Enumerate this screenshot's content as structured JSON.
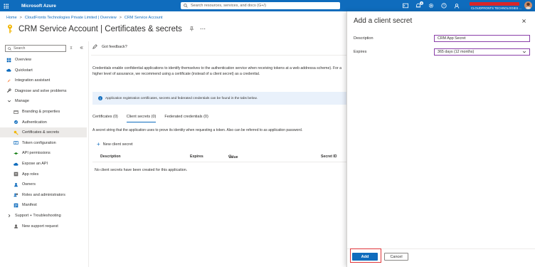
{
  "topbar": {
    "brand": "Microsoft Azure",
    "search_placeholder": "Search resources, services, and docs (G+/)",
    "notifications_count": "3",
    "account_org": "CLOUDFRONTS TECHNOLOGIES ..."
  },
  "breadcrumb": {
    "home": "Home",
    "sep1": ">",
    "tenant": "CloudFronts Technologies Private Limited | Overview",
    "sep2": ">",
    "app": "CRM Service Account"
  },
  "page": {
    "title_app": "CRM Service Account",
    "title_sep": "|",
    "title_section": "Certificates & secrets"
  },
  "nav": {
    "search_placeholder": "Search",
    "items": [
      {
        "label": "Overview",
        "icon": "grid-icon"
      },
      {
        "label": "Quickstart",
        "icon": "cloud-icon"
      },
      {
        "label": "Integration assistant",
        "icon": "rocket-icon"
      },
      {
        "label": "Diagnose and solve problems",
        "icon": "wrench-icon"
      },
      {
        "label": "Manage",
        "icon": "chevron-down-icon"
      },
      {
        "label": "Branding & properties",
        "icon": "branding-icon"
      },
      {
        "label": "Authentication",
        "icon": "auth-icon"
      },
      {
        "label": "Certificates & secrets",
        "icon": "key-icon"
      },
      {
        "label": "Token configuration",
        "icon": "token-icon"
      },
      {
        "label": "API permissions",
        "icon": "permissions-icon"
      },
      {
        "label": "Expose an API",
        "icon": "cloud-api-icon"
      },
      {
        "label": "App roles",
        "icon": "app-roles-icon"
      },
      {
        "label": "Owners",
        "icon": "owners-icon"
      },
      {
        "label": "Roles and administrators",
        "icon": "roles-icon"
      },
      {
        "label": "Manifest",
        "icon": "manifest-icon"
      },
      {
        "label": "Support + Troubleshooting",
        "icon": "chevron-right-icon"
      },
      {
        "label": "New support request",
        "icon": "support-icon"
      }
    ]
  },
  "content": {
    "feedback": "Got feedback?",
    "description": "Credentials enable confidential applications to identify themselves to the authentication service when receiving tokens at a web addressa scheme). For a higher level of assurance, we recommend using a certificate (instead of a client secret) as a credential.",
    "banner": "Application registration certificates, secrets and federated credentials can be found in the tabs below.",
    "tabs": [
      "Certificates (0)",
      "Client secrets (0)",
      "Federated credentials (0)"
    ],
    "tab_description": "A secret string that the application uses to prove its identity when requesting a token. Also can be referred to as application password.",
    "new_secret": "New client secret",
    "columns": [
      "Description",
      "Expires",
      "Value",
      "Secret ID"
    ],
    "empty": "No client secrets have been created for this application."
  },
  "panel": {
    "title": "Add a client secret",
    "description_label": "Description",
    "description_value": "CRM App Secret",
    "expires_label": "Expires",
    "expires_value": "365 days (12 months)",
    "add_label": "Add",
    "cancel_label": "Cancel"
  },
  "colors": {
    "accent": "#0f6cbd",
    "highlight": "#e0353a"
  }
}
